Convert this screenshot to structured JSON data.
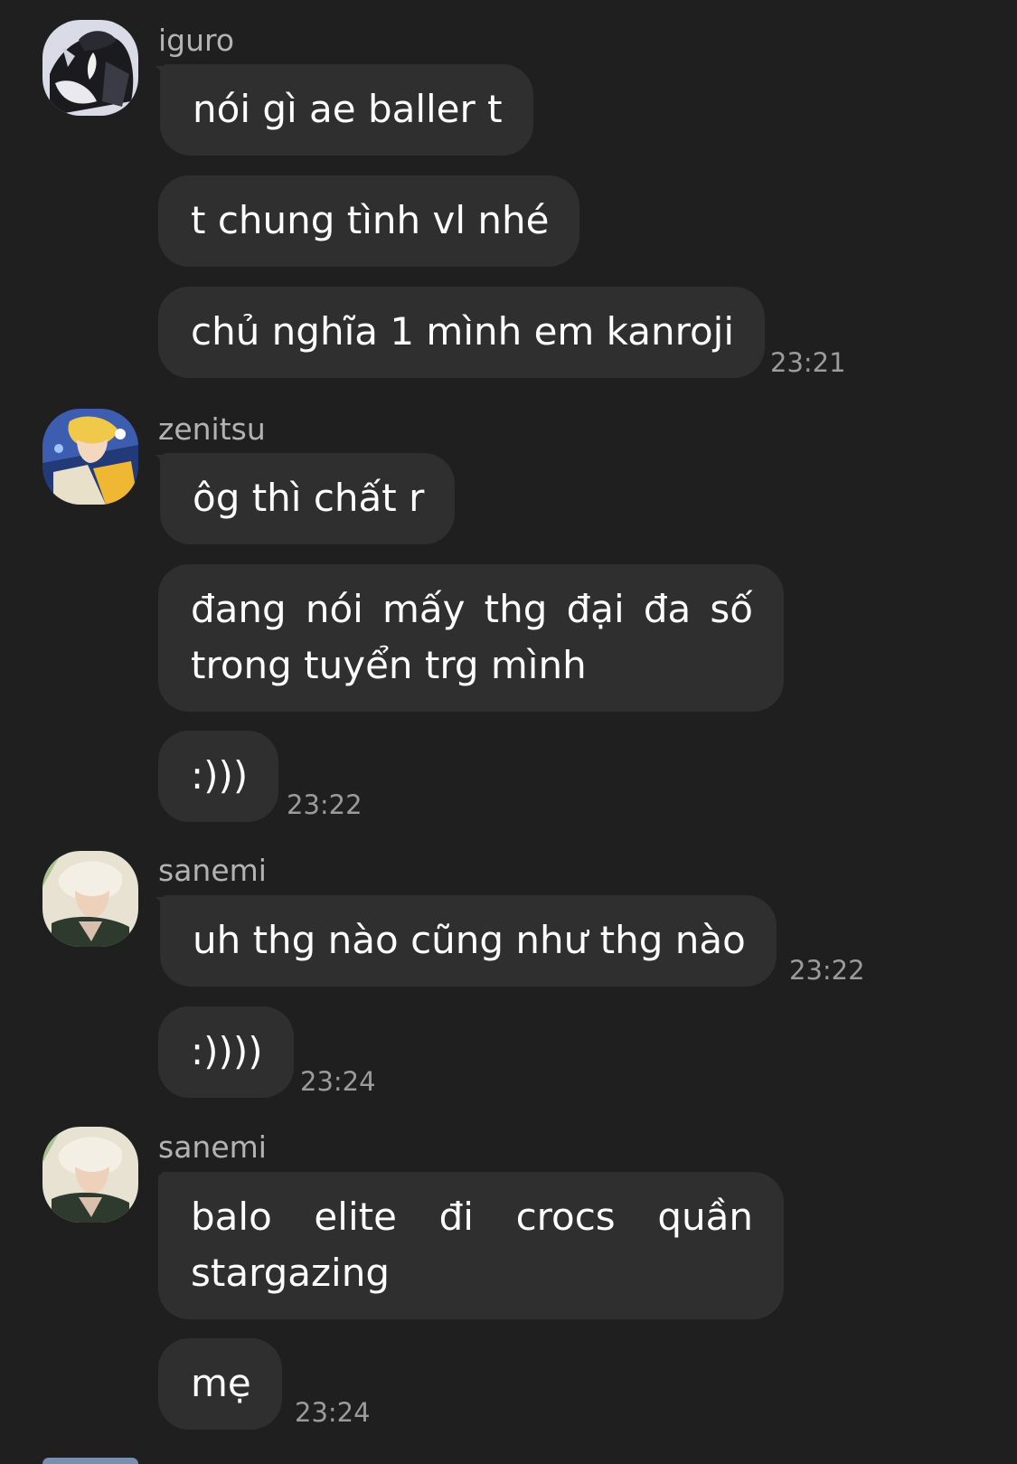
{
  "groups": [
    {
      "sender": "iguro",
      "avatar": "avatar-iguro",
      "messages": [
        {
          "text": "nói gì ae baller t",
          "time": ""
        },
        {
          "text": "t chung tình vl nhé",
          "time": ""
        },
        {
          "text": "chủ nghĩa 1 mình em kanroji",
          "time": "23:21"
        }
      ]
    },
    {
      "sender": "zenitsu",
      "avatar": "avatar-zenitsu",
      "messages": [
        {
          "text": "ôg thì chất r",
          "time": ""
        },
        {
          "text": "đang nói mấy thg đại đa số trong tuyển trg mình",
          "time": ""
        },
        {
          "text": ":)))",
          "time": "23:22"
        }
      ]
    },
    {
      "sender": "sanemi",
      "avatar": "avatar-sanemi",
      "messages": [
        {
          "text": "uh thg nào cũng như thg nào",
          "time": "23:22"
        },
        {
          "text": ":))))",
          "time": "23:24"
        }
      ]
    },
    {
      "sender": "sanemi",
      "avatar": "avatar-sanemi",
      "messages": [
        {
          "text": "balo elite đi crocs quần stargazing",
          "time": ""
        },
        {
          "text": "mẹ",
          "time": "23:24"
        }
      ]
    }
  ],
  "colors": {
    "background": "#1f1f1f",
    "bubble": "#2f2f2f",
    "sender_text": "#b3b3b3",
    "message_text": "#ffffff",
    "time_text": "#9b9b9b"
  }
}
